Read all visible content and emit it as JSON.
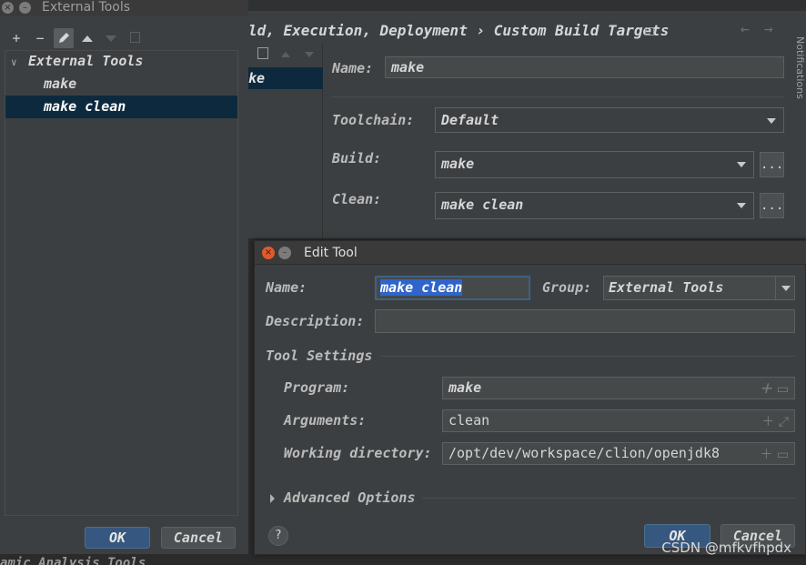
{
  "settings": {
    "breadcrumb_path": "ld, Execution, Deployment",
    "breadcrumb_sep": "›",
    "breadcrumb_current": "Custom Build Targets",
    "back_arrow": "←",
    "forward_arrow": "→",
    "list_item": "ke",
    "name_label": "Name:",
    "name_value": "make",
    "toolchain_label": "Toolchain:",
    "toolchain_value": "Default",
    "build_label": "Build:",
    "build_value": "make",
    "clean_label": "Clean:",
    "clean_value": "make clean",
    "browse_label": "...",
    "side_tab_label": "Notifications"
  },
  "external_tools": {
    "window_title": "External Tools",
    "toolbar": {
      "add": "+",
      "remove": "−",
      "edit_icon": "pencil-icon",
      "up_icon": "arrow-up-icon",
      "down_icon": "arrow-down-icon",
      "copy_icon": "copy-icon"
    },
    "tree": {
      "group": "External Tools",
      "items": [
        "make",
        "make clean"
      ],
      "selected_index": 1
    },
    "ok_label": "OK",
    "cancel_label": "Cancel",
    "bottom_text": "amic Analysis Tools"
  },
  "edit_tool": {
    "title": "Edit Tool",
    "name_label": "Name:",
    "name_value": "make clean",
    "group_label": "Group:",
    "group_value": "External Tools",
    "description_label": "Description:",
    "description_value": "",
    "section_title": "Tool Settings",
    "program_label": "Program:",
    "program_value": "make",
    "arguments_label": "Arguments:",
    "arguments_value": "clean",
    "workdir_label": "Working directory:",
    "workdir_value": "/opt/dev/workspace/clion/openjdk8",
    "advanced_label": "Advanced Options",
    "help_label": "?",
    "ok_label": "OK",
    "cancel_label": "Cancel"
  },
  "watermark": "CSDN @mfkvfhpdx",
  "colors": {
    "background": "#2b2b2b",
    "panel": "#3c3f41",
    "selection": "#0d293e",
    "text_highlight": "#2f65ca",
    "primary_button": "#365880",
    "close_button": "#e05a2b"
  }
}
